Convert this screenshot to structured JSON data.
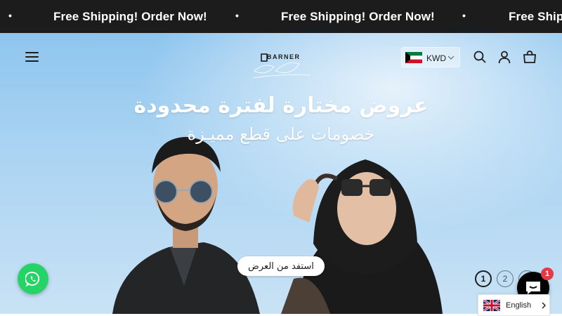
{
  "announcement": {
    "message": "Free Shipping! Order Now!",
    "separator": "•",
    "background": "#1c1c1c"
  },
  "header": {
    "logo_text": "BARNER",
    "currency": {
      "code": "KWD",
      "flag": "kuwait-flag-icon"
    },
    "icons": [
      "menu-icon",
      "search-icon",
      "account-icon",
      "cart-icon"
    ]
  },
  "hero": {
    "headline": "عروض مختارة لفترة محدودة",
    "subheadline": "خصومات على قطع مميـزة",
    "cta_label": "استفد من العرض",
    "slides": [
      "1",
      "2",
      "3"
    ],
    "active_slide": "1"
  },
  "floating": {
    "chat_badge": "1",
    "language_label": "English",
    "whatsapp_color": "#25d366"
  }
}
